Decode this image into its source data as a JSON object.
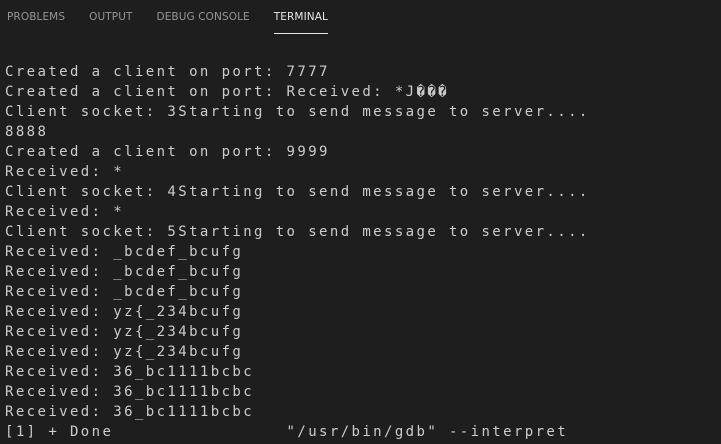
{
  "tabs": [
    {
      "label": "PROBLEMS",
      "active": false
    },
    {
      "label": "OUTPUT",
      "active": false
    },
    {
      "label": "DEBUG CONSOLE",
      "active": false
    },
    {
      "label": "TERMINAL",
      "active": true
    }
  ],
  "terminal": {
    "lines": [
      "Created a client on port: 7777",
      "Created a client on port: Received: *J���",
      "Client socket: 3Starting to send message to server....",
      "8888",
      "Created a client on port: 9999",
      "Received: *",
      "Client socket: 4Starting to send message to server....",
      "Received: *",
      "Client socket: 5Starting to send message to server....",
      "Received: _bcdef_bcufg",
      "Received: _bcdef_bcufg",
      "Received: _bcdef_bcufg",
      "Received: yz{_234bcufg",
      "Received: yz{_234bcufg",
      "Received: yz{_234bcufg",
      "Received: 36_bc1111bcbc",
      "Received: 36_bc1111bcbc",
      "Received: 36_bc1111bcbc",
      "[1] + Done                \"/usr/bin/gdb\" --interpret"
    ]
  },
  "colors": {
    "background": "#1e1e1e",
    "terminal_text": "#cccccc",
    "tab_inactive": "#969696",
    "tab_active": "#e7e7e7"
  }
}
